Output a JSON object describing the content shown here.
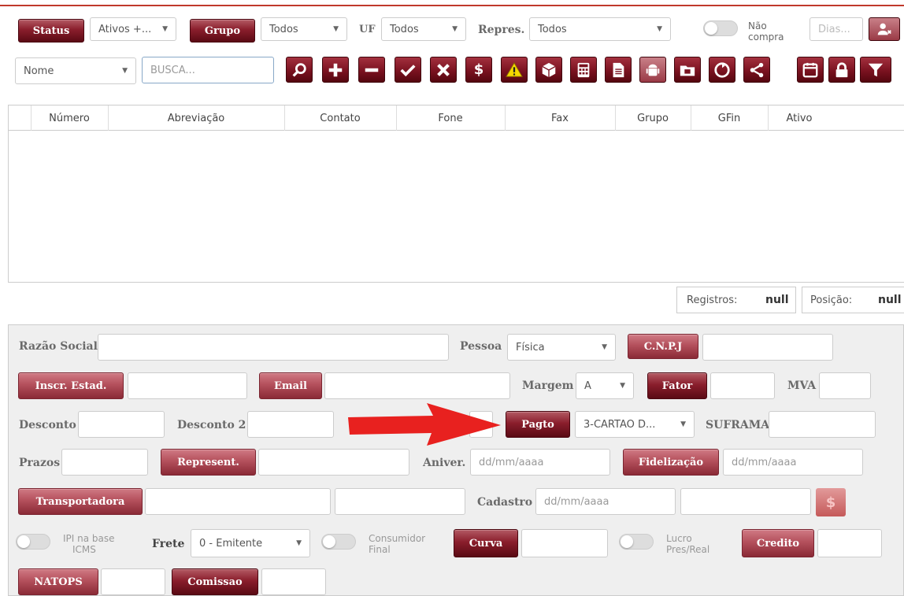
{
  "toolbar": {
    "status_label": "Status",
    "status_value": "Ativos +...",
    "grupo_label": "Grupo",
    "grupo_value": "Todos",
    "uf_label": "UF",
    "uf_value": "Todos",
    "repres_label": "Repres.",
    "repres_value": "Todos",
    "nao_compra_label_1": "Não",
    "nao_compra_label_2": "compra",
    "dias_placeholder": "Dias...",
    "search_field_value": "Nome",
    "search_placeholder": "BUSCA..."
  },
  "icons": [
    "search-icon",
    "plus-icon",
    "minus-icon",
    "check-icon",
    "x-icon",
    "dollar-icon",
    "warning-icon",
    "box-icon",
    "calculator-icon",
    "document-icon",
    "android-icon",
    "folder-icon",
    "recycle-icon",
    "share-icon",
    "calendar-icon",
    "lock-icon",
    "filter-icon"
  ],
  "table": {
    "columns": [
      "Número",
      "Abreviação",
      "Contato",
      "Fone",
      "Fax",
      "Grupo",
      "GFin",
      "Ativo"
    ]
  },
  "status": {
    "registros_label": "Registros:",
    "registros_value": "null",
    "posicao_label": "Posição:",
    "posicao_value": "null"
  },
  "form": {
    "razao_social": "Razão Social",
    "pessoa": "Pessoa",
    "pessoa_value": "Física",
    "cnpj": "C.N.P.J",
    "inscr_estad": "Inscr. Estad.",
    "email": "Email",
    "margem": "Margem",
    "margem_value": "A",
    "fator": "Fator",
    "mva": "MVA",
    "desconto": "Desconto",
    "desconto2": "Desconto 2",
    "pagto": "Pagto",
    "pagto_value": "3-CARTAO D...",
    "suframa": "SUFRAMA",
    "prazos": "Prazos",
    "represent": "Represent.",
    "aniver": "Aniver.",
    "date_placeholder": "dd/mm/aaaa",
    "fidelizacao": "Fidelização",
    "transportadora": "Transportadora",
    "cadastro": "Cadastro",
    "ipi_1": "IPI na base",
    "ipi_2": "ICMS",
    "frete": "Frete",
    "frete_value": "0 - Emitente",
    "consumidor_1": "Consumidor",
    "consumidor_2": "Final",
    "curva": "Curva",
    "lucro_1": "Lucro",
    "lucro_2": "Pres/Real",
    "credito": "Credito",
    "natops": "NATOPS",
    "comissao": "Comissao"
  },
  "colors": {
    "accent": "#7a1220",
    "arrow": "#e8211f"
  }
}
